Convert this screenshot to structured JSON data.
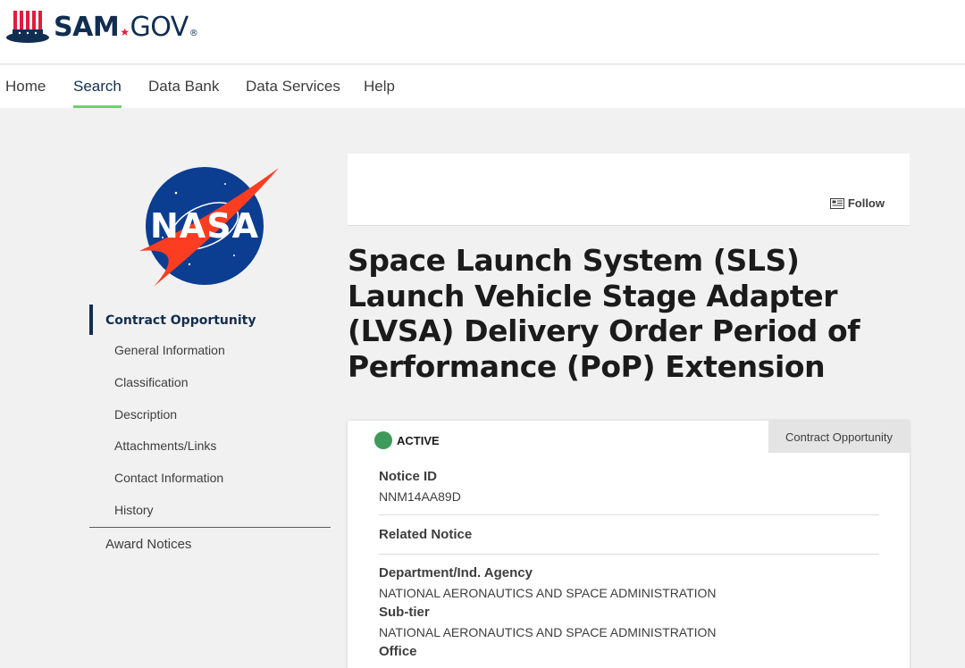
{
  "brand": {
    "name_bold": "SAM",
    "name_rest": "GOV",
    "reg": "®"
  },
  "nav": {
    "items": [
      {
        "label": "Home"
      },
      {
        "label": "Search"
      },
      {
        "label": "Data Bank"
      },
      {
        "label": "Data Services"
      },
      {
        "label": "Help"
      }
    ],
    "active": "Search"
  },
  "agency_logo": {
    "icon": "nasa-logo",
    "text": "NASA"
  },
  "sidenav": {
    "primary": "Contract Opportunity",
    "sub_items": [
      {
        "label": "General Information"
      },
      {
        "label": "Classification"
      },
      {
        "label": "Description"
      },
      {
        "label": "Attachments/Links"
      },
      {
        "label": "Contact Information"
      },
      {
        "label": "History"
      }
    ],
    "secondary": "Award Notices"
  },
  "follow": {
    "label": "Follow",
    "icon": "newspaper-icon"
  },
  "title": "Space Launch System (SLS) Launch Vehicle Stage Adapter (LVSA) Delivery Order Period of Performance (PoP) Extension",
  "notice": {
    "status": "ACTIVE",
    "status_color": "#3e9b5c",
    "type_tab": "Contract Opportunity",
    "notice_id_label": "Notice ID",
    "notice_id": "NNM14AA89D",
    "related_label": "Related Notice",
    "department_label": "Department/Ind. Agency",
    "department": "NATIONAL AERONAUTICS AND SPACE ADMINISTRATION",
    "subtier_label": "Sub-tier",
    "subtier": "NATIONAL AERONAUTICS AND SPACE ADMINISTRATION",
    "office_label": "Office"
  },
  "colors": {
    "brand_navy": "#112e51",
    "accent_red": "#e31c3d",
    "active_tab": "#6fd16b"
  }
}
